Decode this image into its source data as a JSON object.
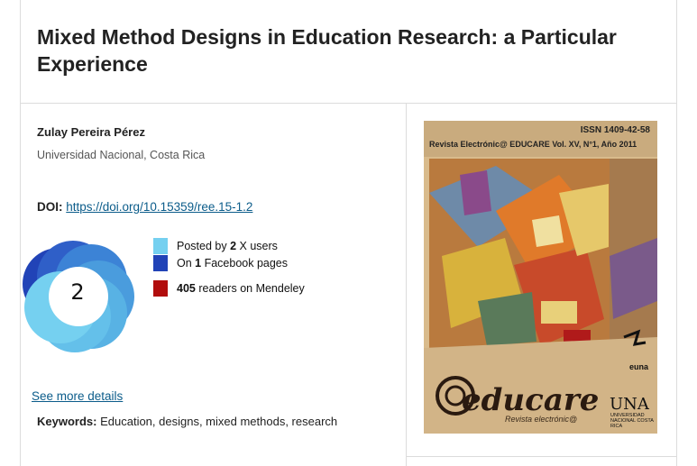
{
  "article": {
    "title": "Mixed Method Designs in Education Research: a Particular Experience",
    "author": "Zulay Pereira Pérez",
    "affiliation": "Universidad Nacional, Costa Rica",
    "doi_label": "DOI:",
    "doi_link": "https://doi.org/10.15359/ree.15-1.2",
    "keywords_label": "Keywords:",
    "keywords": "Education, designs, mixed methods, research"
  },
  "altmetric": {
    "score": "2",
    "legend": [
      {
        "prefix": "Posted by ",
        "count": "2",
        "suffix": " X users",
        "color": "#75d0f0"
      },
      {
        "prefix": "On ",
        "count": "1",
        "suffix": " Facebook pages",
        "color": "#2143b7"
      },
      {
        "prefix": "",
        "count": "405",
        "suffix": " readers on Mendeley",
        "color": "#b10d0d"
      }
    ],
    "see_more": "See more details"
  },
  "cover": {
    "issn": "ISSN 1409-42-58",
    "journal_line": "Revista Electrónic@ EDUCARE Vol. XV, N°1, Año 2011",
    "brand": "educare",
    "brand_sub": "Revista electrónic@",
    "publisher_logo": "euna",
    "university": "UNA",
    "university_sub": "UNIVERSIDAD NACIONAL COSTA RICA"
  }
}
